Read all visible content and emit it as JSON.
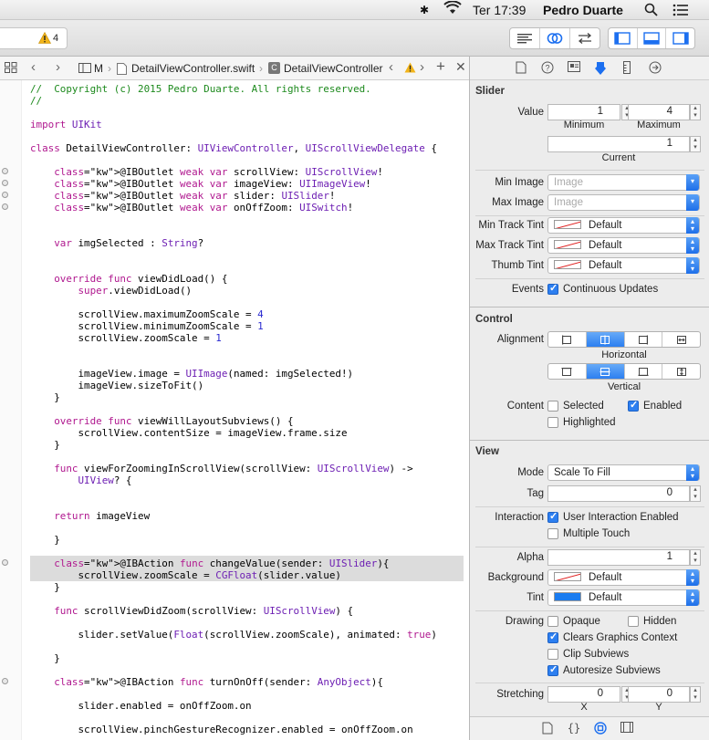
{
  "menubar": {
    "day_time": "Ter 17:39",
    "user": "Pedro Duarte"
  },
  "toolbar": {
    "warning_count": "4"
  },
  "jumpbar": {
    "crumb1": "M",
    "file": "DetailViewController.swift",
    "symbol": "DetailViewController"
  },
  "code": [
    "//  Copyright (c) 2015 Pedro Duarte. All rights reserved.",
    "//",
    "import UIKit",
    "class DetailViewController: UIViewController, UIScrollViewDelegate {",
    "    @IBOutlet weak var scrollView: UIScrollView!",
    "    @IBOutlet weak var imageView: UIImageView!",
    "    @IBOutlet weak var slider: UISlider!",
    "    @IBOutlet weak var onOffZoom: UISwitch!",
    "    var imgSelected : String?",
    "    override func viewDidLoad() {",
    "        super.viewDidLoad()",
    "        scrollView.maximumZoomScale = 4",
    "        scrollView.minimumZoomScale = 1",
    "        scrollView.zoomScale = 1",
    "        imageView.image = UIImage(named: imgSelected!)",
    "        imageView.sizeToFit()",
    "    }",
    "    override func viewWillLayoutSubviews() {",
    "        scrollView.contentSize = imageView.frame.size",
    "    }",
    "    func viewForZoomingInScrollView(scrollView: UIScrollView) ->",
    "        UIView? {",
    "    return imageView",
    "    }",
    "    @IBAction func changeValue(sender: UISlider){",
    "        scrollView.zoomScale = CGFloat(slider.value)",
    "    }",
    "    func scrollViewDidZoom(scrollView: UIScrollView) {",
    "        slider.setValue(Float(scrollView.zoomScale), animated: true)",
    "    }",
    "    @IBAction func turnOnOff(sender: AnyObject){",
    "        slider.enabled = onOffZoom.on",
    "        scrollView.pinchGestureRecognizer.enabled = onOffZoom.on"
  ],
  "inspector": {
    "slider": {
      "title": "Slider",
      "value_label": "Value",
      "min_value": "1",
      "max_value": "4",
      "minimum_label": "Minimum",
      "maximum_label": "Maximum",
      "current_value": "1",
      "current_label": "Current",
      "min_image_label": "Min Image",
      "max_image_label": "Max Image",
      "image_placeholder": "Image",
      "min_track_label": "Min Track Tint",
      "max_track_label": "Max Track Tint",
      "thumb_tint_label": "Thumb Tint",
      "default_label": "Default",
      "events_label": "Events",
      "continuous_label": "Continuous Updates"
    },
    "control": {
      "title": "Control",
      "alignment_label": "Alignment",
      "horizontal_label": "Horizontal",
      "vertical_label": "Vertical",
      "content_label": "Content",
      "selected_label": "Selected",
      "enabled_label": "Enabled",
      "highlighted_label": "Highlighted"
    },
    "view": {
      "title": "View",
      "mode_label": "Mode",
      "mode_value": "Scale To Fill",
      "tag_label": "Tag",
      "tag_value": "0",
      "interaction_label": "Interaction",
      "user_interaction_label": "User Interaction Enabled",
      "multiple_touch_label": "Multiple Touch",
      "alpha_label": "Alpha",
      "alpha_value": "1",
      "background_label": "Background",
      "background_value": "Default",
      "tint_label": "Tint",
      "tint_value": "Default",
      "tint_color": "#1a7cf0",
      "drawing_label": "Drawing",
      "opaque_label": "Opaque",
      "hidden_label": "Hidden",
      "clears_label": "Clears Graphics Context",
      "clip_label": "Clip Subviews",
      "autoresize_label": "Autoresize Subviews",
      "stretching_label": "Stretching",
      "stretch_x": "0",
      "stretch_y": "0",
      "x_label": "X",
      "y_label": "Y"
    }
  }
}
